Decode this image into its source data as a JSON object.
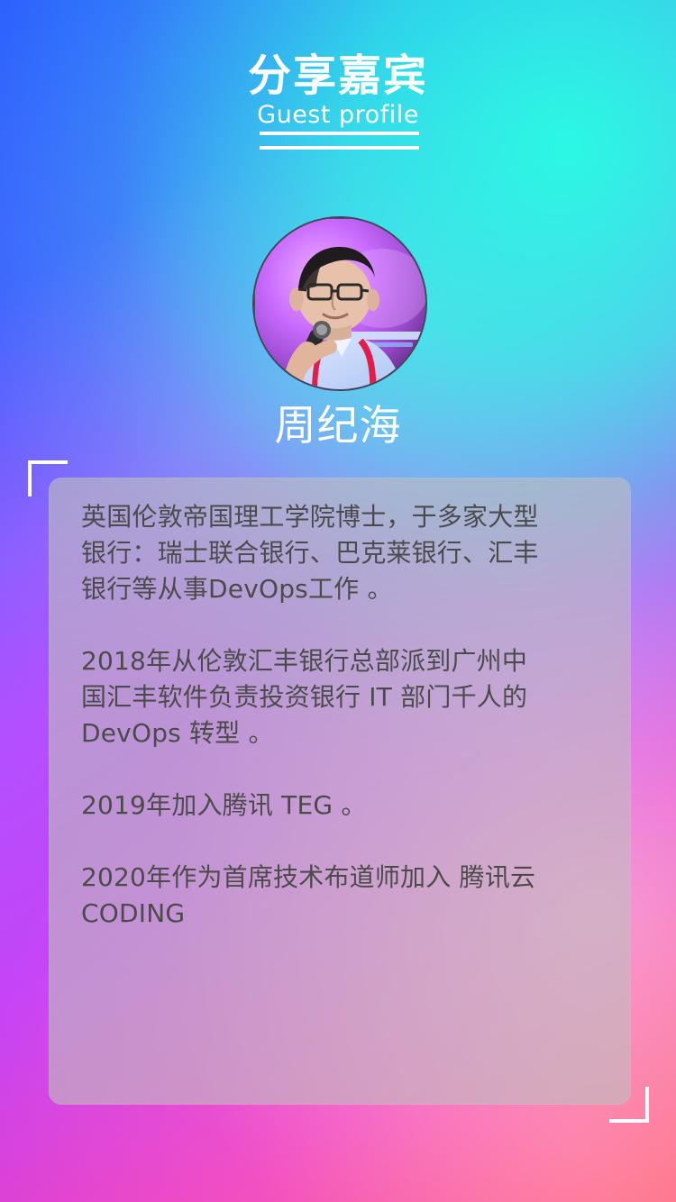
{
  "header": {
    "title_cn": "分享嘉宾",
    "title_en": "Guest profile"
  },
  "guest": {
    "name": "周纪海"
  },
  "profile": {
    "paragraphs": [
      "英国伦敦帝国理工学院博士，于多家大型\n银行：瑞士联合银行、巴克莱银行、汇丰\n银行等从事DevOps工作 。",
      "2018年从伦敦汇丰银行总部派到广州中\n国汇丰软件负责投资银行 IT 部门千人的\nDevOps 转型 。",
      "2019年加入腾讯 TEG 。",
      "2020年作为首席技术布道师加入 腾讯云\nCODING"
    ]
  },
  "colors": {
    "background_start": "#2d58ff",
    "background_mid": "#b250ff",
    "background_end": "#ff4b6d",
    "cyan_glow": "#27ffe2",
    "text_white": "#ffffff",
    "card_text": "#4b4b4b"
  },
  "icons": {
    "top_left_corner": "corner-bracket-icon",
    "bottom_right_corner": "corner-bracket-icon"
  }
}
